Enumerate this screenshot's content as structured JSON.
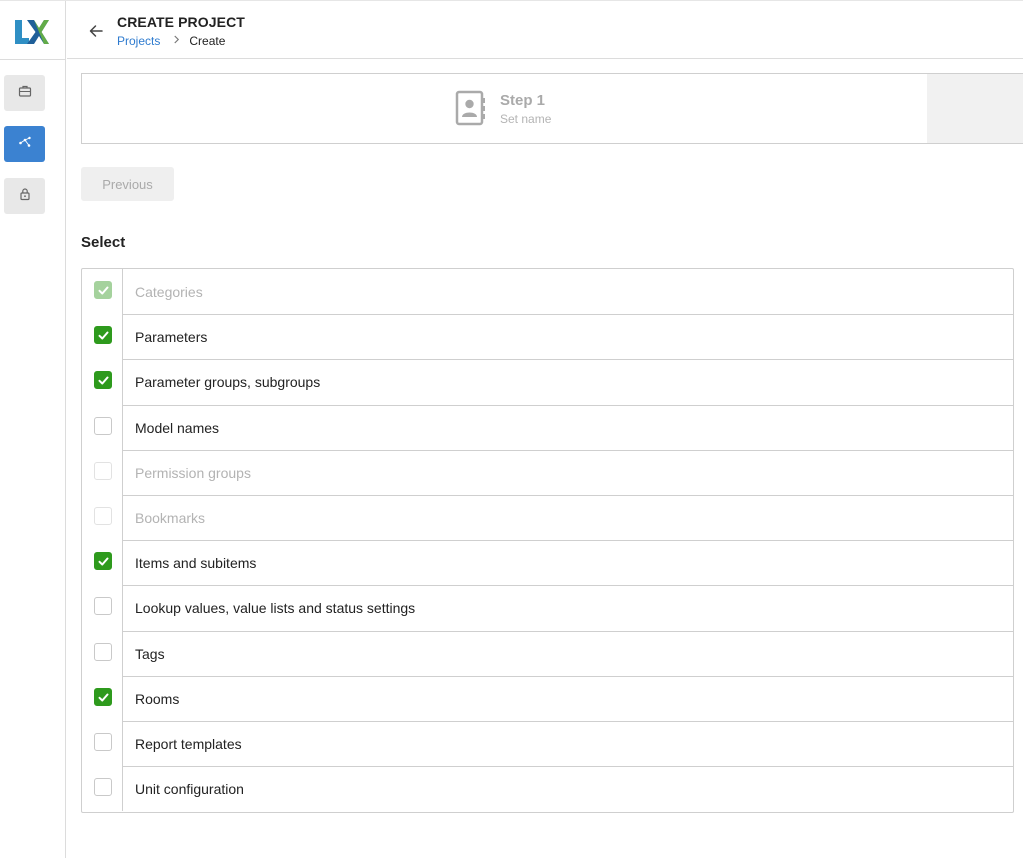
{
  "header": {
    "title": "CREATE PROJECT",
    "breadcrumb": {
      "link": "Projects",
      "current": "Create"
    }
  },
  "sidebar": {
    "items": [
      {
        "icon": "briefcase-icon",
        "active": false
      },
      {
        "icon": "network-icon",
        "active": true
      },
      {
        "icon": "lock-icon",
        "active": false
      }
    ]
  },
  "stepper": {
    "step_title": "Step 1",
    "step_subtitle": "Set name",
    "icon": "contact-book-icon"
  },
  "buttons": {
    "previous": "Previous"
  },
  "section": {
    "label": "Select"
  },
  "colors": {
    "accent": "#3b82d1",
    "link": "#2e7bcf",
    "checked": "#2e9a1d",
    "checked_disabled": "#a5d29d"
  },
  "options": [
    {
      "label": "Categories",
      "checked": true,
      "disabled": true
    },
    {
      "label": "Parameters",
      "checked": true,
      "disabled": false
    },
    {
      "label": "Parameter groups, subgroups",
      "checked": true,
      "disabled": false
    },
    {
      "label": "Model names",
      "checked": false,
      "disabled": false
    },
    {
      "label": "Permission groups",
      "checked": false,
      "disabled": true
    },
    {
      "label": "Bookmarks",
      "checked": false,
      "disabled": true
    },
    {
      "label": "Items and subitems",
      "checked": true,
      "disabled": false
    },
    {
      "label": "Lookup values, value lists and status settings",
      "checked": false,
      "disabled": false
    },
    {
      "label": "Tags",
      "checked": false,
      "disabled": false
    },
    {
      "label": "Rooms",
      "checked": true,
      "disabled": false
    },
    {
      "label": "Report templates",
      "checked": false,
      "disabled": false
    },
    {
      "label": "Unit configuration",
      "checked": false,
      "disabled": false
    }
  ]
}
